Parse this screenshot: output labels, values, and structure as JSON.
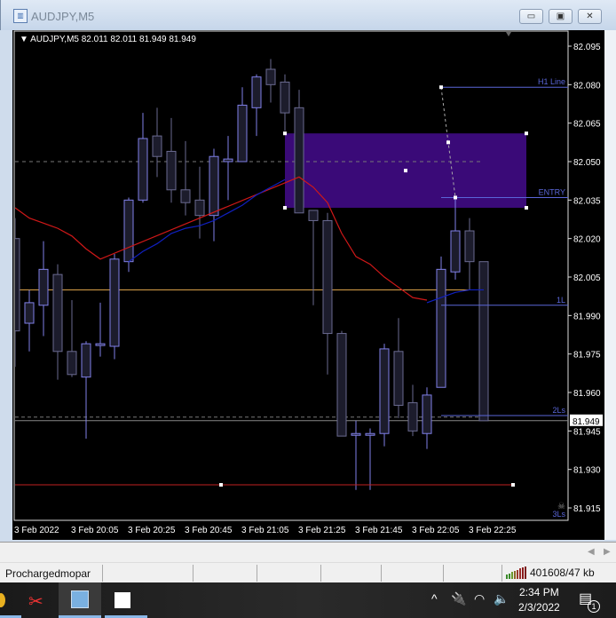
{
  "window": {
    "title": "AUDJPY,M5",
    "minimize": "▭",
    "maximize": "▣",
    "close": "✕"
  },
  "chart": {
    "header": "AUDJPY,M5  82.011 82.011 81.949 81.949",
    "symbol": "AUDJPY",
    "timeframe": "M5"
  },
  "chart_data": {
    "type": "candlestick",
    "x_labels": [
      "3 Feb 2022",
      "3 Feb 20:05",
      "3 Feb 20:25",
      "3 Feb 20:45",
      "3 Feb 21:05",
      "3 Feb 21:25",
      "3 Feb 21:45",
      "3 Feb 22:05",
      "3 Feb 22:25"
    ],
    "y_ticks": [
      "82.095",
      "82.080",
      "82.065",
      "82.050",
      "82.035",
      "82.020",
      "82.005",
      "81.990",
      "81.975",
      "81.960",
      "81.945",
      "81.930",
      "81.915"
    ],
    "ylim": [
      81.91,
      82.101
    ],
    "current_price": "81.949",
    "ohlc": [
      [
        82.02,
        82.028,
        81.97,
        81.984
      ],
      [
        81.987,
        82.0,
        81.976,
        81.995
      ],
      [
        81.994,
        82.019,
        81.982,
        82.008
      ],
      [
        82.006,
        82.01,
        81.965,
        81.976
      ],
      [
        81.976,
        81.996,
        81.966,
        81.967
      ],
      [
        81.966,
        81.98,
        81.942,
        81.979
      ],
      [
        81.979,
        81.995,
        81.974,
        81.979
      ],
      [
        81.978,
        82.014,
        81.973,
        82.012
      ],
      [
        82.011,
        82.036,
        82.007,
        82.035
      ],
      [
        82.035,
        82.069,
        82.034,
        82.059
      ],
      [
        82.06,
        82.071,
        82.044,
        82.052
      ],
      [
        82.054,
        82.067,
        82.034,
        82.039
      ],
      [
        82.039,
        82.058,
        82.029,
        82.034
      ],
      [
        82.035,
        82.048,
        82.02,
        82.029
      ],
      [
        82.029,
        82.055,
        82.019,
        82.052
      ],
      [
        82.05,
        82.06,
        82.035,
        82.051
      ],
      [
        82.05,
        82.079,
        82.05,
        82.072
      ],
      [
        82.071,
        82.084,
        82.06,
        82.083
      ],
      [
        82.086,
        82.09,
        82.073,
        82.08
      ],
      [
        82.081,
        82.084,
        82.062,
        82.069
      ],
      [
        82.071,
        82.078,
        82.03,
        82.03
      ],
      [
        82.031,
        82.031,
        81.994,
        82.027
      ],
      [
        82.027,
        82.03,
        81.967,
        81.983
      ],
      [
        81.983,
        81.984,
        81.943,
        81.943
      ],
      [
        81.944,
        81.949,
        81.922,
        81.944
      ],
      [
        81.944,
        81.946,
        81.922,
        81.944
      ],
      [
        81.944,
        81.979,
        81.939,
        81.977
      ],
      [
        81.976,
        81.989,
        81.95,
        81.955
      ],
      [
        81.956,
        81.963,
        81.943,
        81.945
      ],
      [
        81.944,
        81.962,
        81.938,
        81.959
      ],
      [
        81.962,
        82.013,
        81.962,
        82.008
      ],
      [
        82.007,
        82.036,
        82.004,
        82.023
      ],
      [
        82.023,
        82.028,
        82.0,
        82.011
      ],
      [
        82.011,
        82.011,
        81.949,
        81.949
      ]
    ],
    "ma_red": [
      [
        0,
        82.032
      ],
      [
        1,
        82.028
      ],
      [
        2,
        82.026
      ],
      [
        3,
        82.024
      ],
      [
        4,
        82.021
      ],
      [
        5,
        82.016
      ],
      [
        6,
        82.012
      ],
      [
        20,
        82.044
      ],
      [
        21,
        82.04
      ],
      [
        22,
        82.034
      ],
      [
        23,
        82.022
      ],
      [
        24,
        82.013
      ],
      [
        25,
        82.01
      ],
      [
        26,
        82.005
      ],
      [
        27,
        82.001
      ],
      [
        28,
        81.997
      ],
      [
        29,
        81.996
      ]
    ],
    "ma_blue": [
      [
        8,
        82.011
      ],
      [
        9,
        82.015
      ],
      [
        10,
        82.018
      ],
      [
        11,
        82.022
      ],
      [
        12,
        82.024
      ],
      [
        13,
        82.025
      ],
      [
        14,
        82.027
      ],
      [
        15,
        82.03
      ],
      [
        16,
        82.033
      ],
      [
        17,
        82.037
      ],
      [
        18,
        82.04
      ],
      [
        19,
        82.043
      ]
    ],
    "ma_blue2": [
      [
        29,
        81.995
      ],
      [
        30,
        81.997
      ],
      [
        31,
        81.999
      ],
      [
        32,
        82.0
      ],
      [
        33,
        82.0
      ]
    ],
    "zone": {
      "from_bar": 19,
      "to_bar": 36,
      "top": 82.061,
      "bottom": 82.032,
      "color": "#3a0a78"
    },
    "lines": [
      {
        "name": "H1 Line",
        "label": "H1 Line",
        "price": 82.079,
        "from_bar": 30,
        "color": "#5a66d8"
      },
      {
        "name": "ENTRY",
        "label": "ENTRY",
        "price": 82.036,
        "from_bar": 30,
        "color": "#5a66d8"
      },
      {
        "name": "1L",
        "label": "1L",
        "price": 81.994,
        "from_bar": 30,
        "color": "#5a66d8"
      },
      {
        "name": "2Ls",
        "label": "2Ls",
        "price": 81.951,
        "from_bar": 30,
        "color": "#5a66d8"
      }
    ],
    "level_orange": {
      "price": 82.0,
      "color": "#d8a048"
    },
    "level_red": {
      "price": 81.924,
      "color": "#c02020"
    },
    "level_dashed": {
      "price": 82.05
    },
    "trend_segment": {
      "from": [
        30,
        82.079
      ],
      "to": [
        31,
        82.036
      ]
    },
    "bottom_label": "3Ls",
    "colors": {
      "bull": "#8080e8",
      "bear": "#6a6a90",
      "body": "#1c1c2c"
    }
  },
  "status": {
    "user": "Prochargedmopar",
    "connection": "401608/47 kb"
  },
  "taskbar": {
    "time": "2:34 PM",
    "date": "2/3/2022",
    "notifications": "1"
  }
}
